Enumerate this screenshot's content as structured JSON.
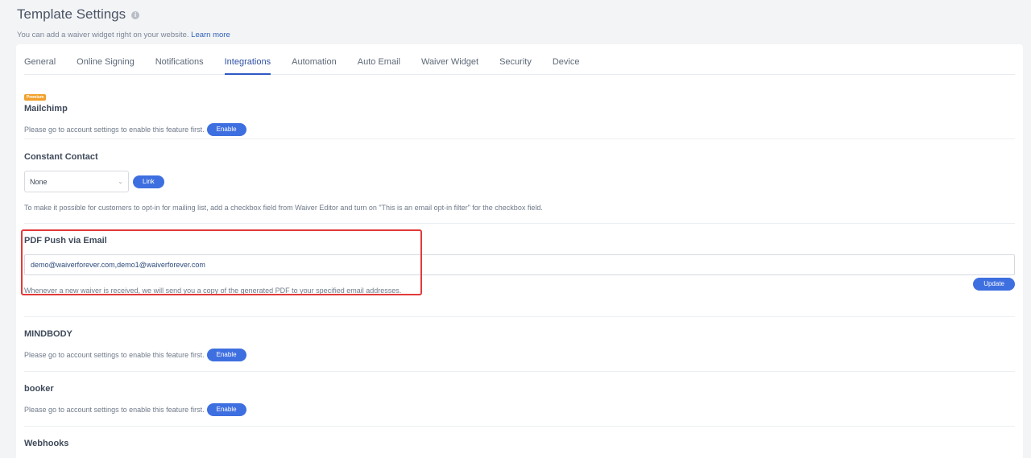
{
  "header": {
    "title": "Template Settings",
    "info_icon": "i",
    "subtitle": "You can add a waiver widget right on your website.",
    "learn_more": "Learn more"
  },
  "tabs": [
    {
      "label": "General",
      "active": false
    },
    {
      "label": "Online Signing",
      "active": false
    },
    {
      "label": "Notifications",
      "active": false
    },
    {
      "label": "Integrations",
      "active": true
    },
    {
      "label": "Automation",
      "active": false
    },
    {
      "label": "Auto Email",
      "active": false
    },
    {
      "label": "Waiver Widget",
      "active": false
    },
    {
      "label": "Security",
      "active": false
    },
    {
      "label": "Device",
      "active": false
    }
  ],
  "mailchimp": {
    "badge": "Premium",
    "title": "Mailchimp",
    "desc": "Please go to account settings to enable this feature first.",
    "button": "Enable"
  },
  "constant_contact": {
    "title": "Constant Contact",
    "select_value": "None",
    "button": "Link",
    "desc": "To make it possible for customers to opt-in for mailing list, add a checkbox field from Waiver Editor and turn on \"This is an email opt-in filter\" for the checkbox field."
  },
  "pdf_push": {
    "title": "PDF Push via Email",
    "email_value": "demo@waiverforever.com,demo1@waiverforever.com",
    "button": "Update",
    "desc": "Whenever a new waiver is received, we will send you a copy of the generated PDF to your specified email addresses."
  },
  "mindbody": {
    "title": "MINDBODY",
    "desc": "Please go to account settings to enable this feature first.",
    "button": "Enable"
  },
  "booker": {
    "title": "booker",
    "desc": "Please go to account settings to enable this feature first.",
    "button": "Enable"
  },
  "webhooks": {
    "title": "Webhooks"
  },
  "colors": {
    "accent": "#3e6fe0",
    "highlight": "#e23a3a",
    "premium": "#f2a02a"
  }
}
